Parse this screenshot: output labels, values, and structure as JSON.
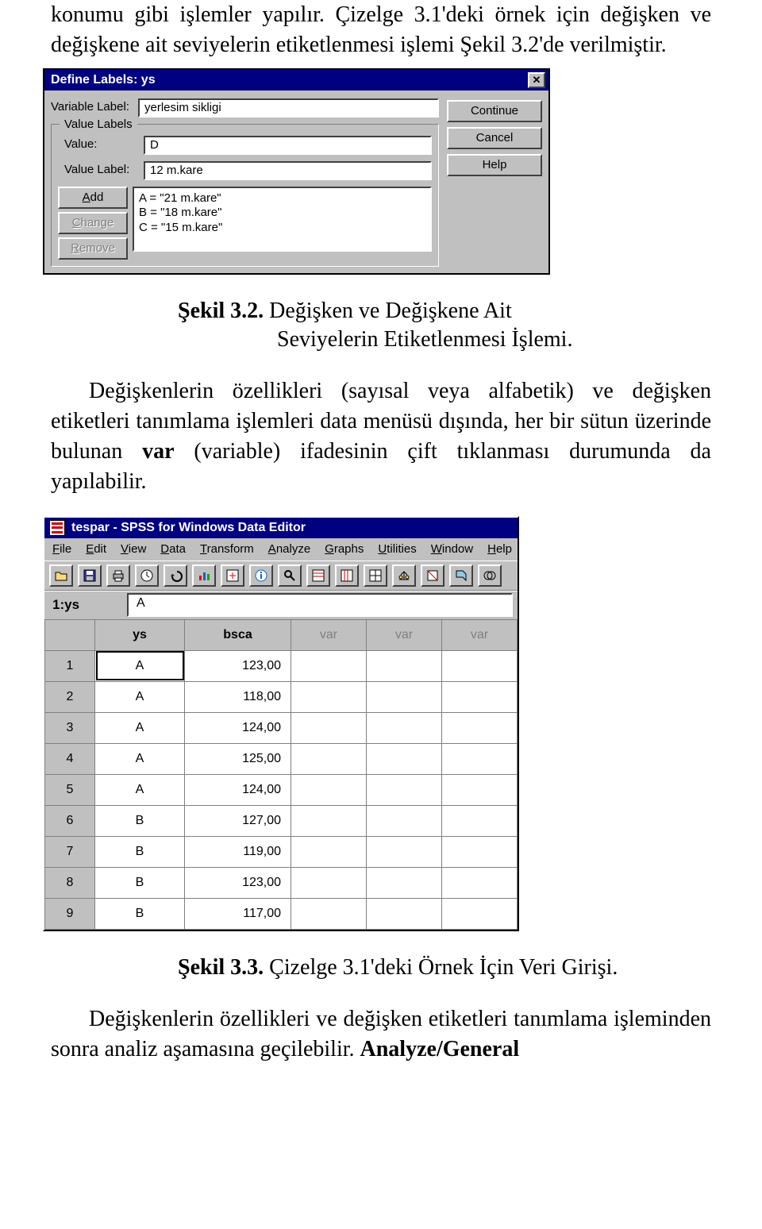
{
  "paragraphs": {
    "p1": "konumu gibi işlemler yapılır. Çizelge 3.1'deki örnek için değişken ve değişkene ait seviyelerin etiketlenmesi işlemi Şekil 3.2'de verilmiştir.",
    "p3_pre_bold": "Değişkenlerin özellikleri (sayısal veya alfabetik) ve değişken etiketleri tanımlama işlemleri data menüsü dışında, her bir sütun üzerinde bulunan ",
    "p3_bold": "var",
    "p3_post_bold": " (variable) ifadesinin çift tıklanması durumunda da yapılabilir.",
    "p5_pre_bold": "Değişkenlerin özellikleri ve değişken etiketleri tanımlama işleminden sonra analiz aşamasına geçilebilir. ",
    "p5_bold": "Analyze/General"
  },
  "captions": {
    "c32_bold": "Şekil 3.2.",
    "c32_rest1": " Değişken ve Değişkene Ait",
    "c32_rest2": "Seviyelerin Etiketlenmesi İşlemi.",
    "c33_bold": "Şekil 3.3.",
    "c33_rest": " Çizelge 3.1'deki Örnek İçin Veri Girişi."
  },
  "dialog": {
    "title": "Define Labels: ys",
    "var_label_label": "Variable Label:",
    "var_label_value": "yerlesim sikligi",
    "groupbox_title": "Value Labels",
    "value_label": "Value:",
    "value_value": "D",
    "valuelabel_label": "Value Label:",
    "valuelabel_value": "12 m.kare",
    "btn_add": "Add",
    "btn_change": "Change",
    "btn_remove": "Remove",
    "btn_continue": "Continue",
    "btn_cancel": "Cancel",
    "btn_help": "Help",
    "list": {
      "0": "A = \"21 m.kare\"",
      "1": "B = \"18 m.kare\"",
      "2": "C = \"15 m.kare\""
    }
  },
  "spss": {
    "title": "tespar - SPSS for Windows Data Editor",
    "menu": {
      "0": "File",
      "1": "Edit",
      "2": "View",
      "3": "Data",
      "4": "Transform",
      "5": "Analyze",
      "6": "Graphs",
      "7": "Utilities",
      "8": "Window",
      "9": "Help"
    },
    "cellref_name": "1:ys",
    "cellref_value": "A",
    "columns": {
      "0": "ys",
      "1": "bsca",
      "2": "var",
      "3": "var",
      "4": "var"
    },
    "rows": {
      "0": {
        "n": "1",
        "ys": "A",
        "bsca": "123,00"
      },
      "1": {
        "n": "2",
        "ys": "A",
        "bsca": "118,00"
      },
      "2": {
        "n": "3",
        "ys": "A",
        "bsca": "124,00"
      },
      "3": {
        "n": "4",
        "ys": "A",
        "bsca": "125,00"
      },
      "4": {
        "n": "5",
        "ys": "A",
        "bsca": "124,00"
      },
      "5": {
        "n": "6",
        "ys": "B",
        "bsca": "127,00"
      },
      "6": {
        "n": "7",
        "ys": "B",
        "bsca": "119,00"
      },
      "7": {
        "n": "8",
        "ys": "B",
        "bsca": "123,00"
      },
      "8": {
        "n": "9",
        "ys": "B",
        "bsca": "117,00"
      }
    }
  }
}
